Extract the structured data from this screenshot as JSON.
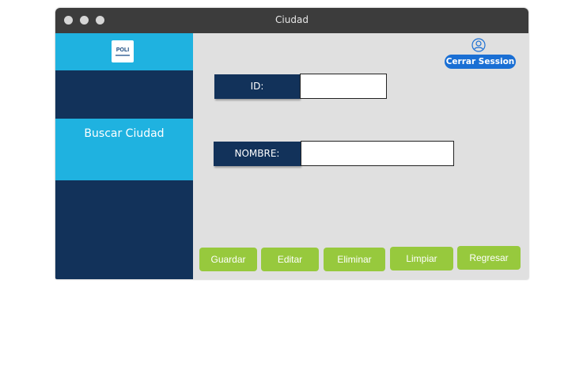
{
  "window": {
    "title": "Ciudad"
  },
  "sidebar": {
    "logo_text": "POLI",
    "active_item": "Buscar Ciudad"
  },
  "header": {
    "user_icon": "user-circle-icon",
    "logout_label": "Cerrar Session"
  },
  "form": {
    "id_label": "ID:",
    "id_value": "",
    "nombre_label": "NOMBRE:",
    "nombre_value": ""
  },
  "buttons": {
    "guardar": "Guardar",
    "editar": "Editar",
    "eliminar": "Eliminar",
    "limpiar": "Limpiar",
    "regresar": "Regresar"
  },
  "colors": {
    "dark_navy": "#12325a",
    "accent_cyan": "#1fb2e0",
    "button_green": "#97c93d",
    "logout_blue": "#1a6fd4"
  }
}
